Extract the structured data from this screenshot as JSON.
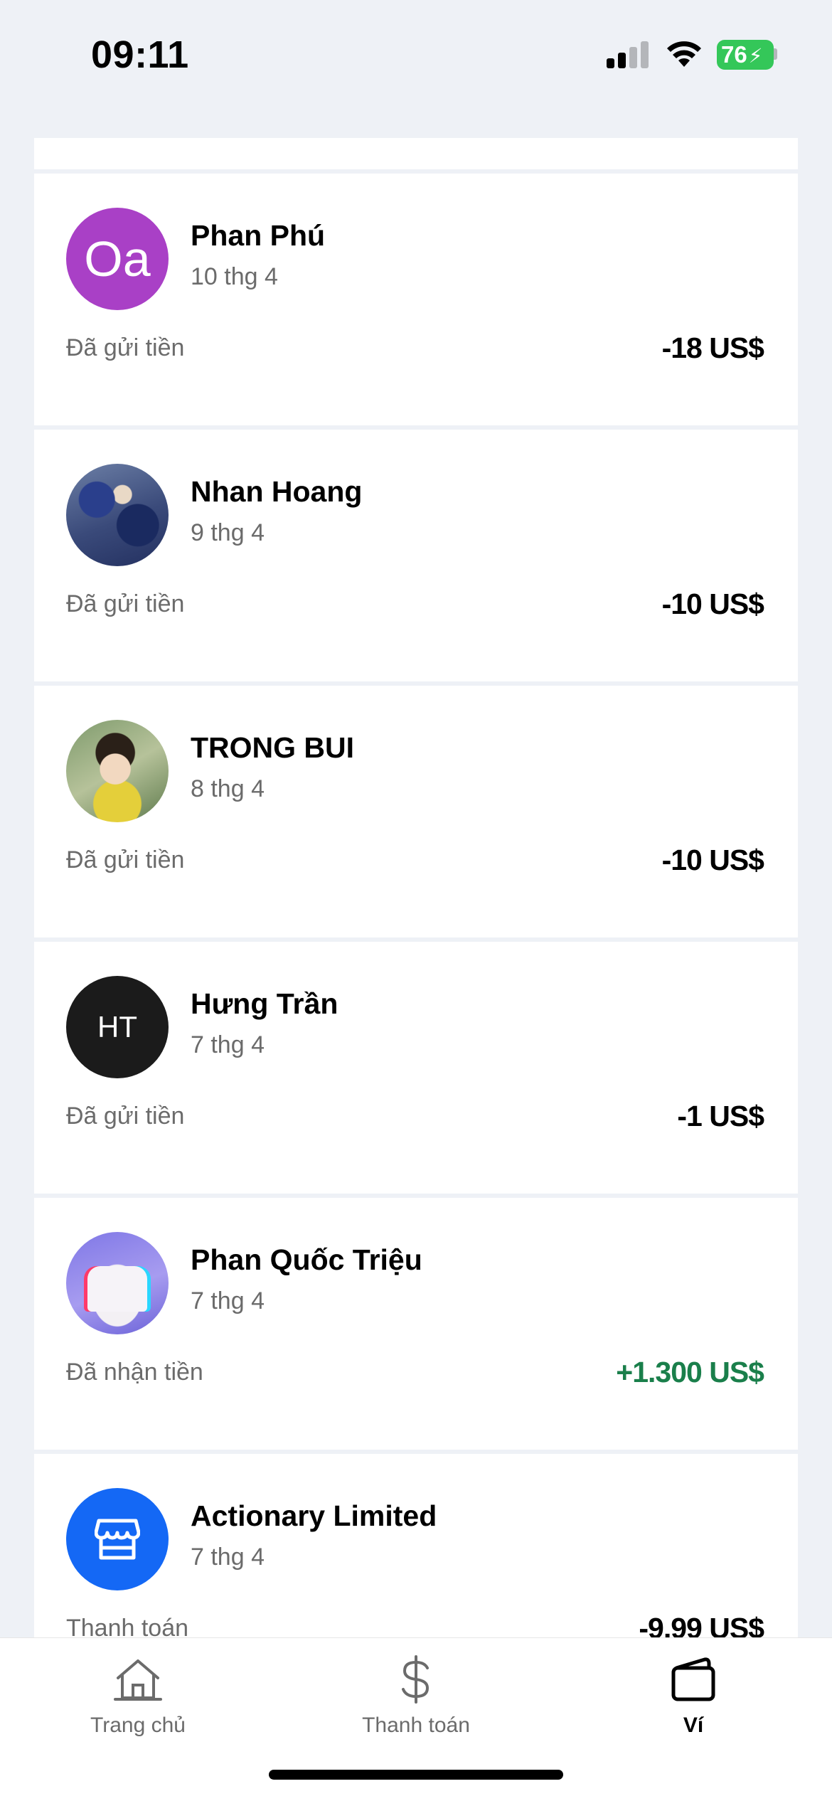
{
  "status_bar": {
    "time": "09:11",
    "battery": "76"
  },
  "transactions": [
    {
      "name": "Phan Phú",
      "date": "10 thg 4",
      "kind": "Đã gửi tiền",
      "amount": "-18 US$",
      "avatar_initials": "Oa",
      "avatar_color": "#a940c6"
    },
    {
      "name": "Nhan Hoang",
      "date": "9 thg 4",
      "kind": "Đã gửi tiền",
      "amount": "-10 US$"
    },
    {
      "name": "TRONG BUI",
      "date": "8 thg 4",
      "kind": "Đã gửi tiền",
      "amount": "-10 US$"
    },
    {
      "name": "Hưng Trần",
      "date": "7 thg 4",
      "kind": "Đã gửi tiền",
      "amount": "-1 US$",
      "avatar_initials": "HT",
      "avatar_color": "#1b1b1b"
    },
    {
      "name": "Phan Quốc Triệu",
      "date": "7 thg 4",
      "kind": "Đã nhận tiền",
      "amount": "+1.300 US$",
      "amount_color": "#1a7f4b"
    },
    {
      "name": "Actionary Limited",
      "date": "7 thg 4",
      "kind": "Thanh toán",
      "amount": "-9,99 US$",
      "avatar_icon": "storefront-icon",
      "avatar_color": "#1468f5"
    }
  ],
  "bottom_nav": {
    "items": [
      {
        "label": "Trang chủ",
        "icon": "home-icon"
      },
      {
        "label": "Thanh toán",
        "icon": "dollar-icon"
      },
      {
        "label": "Ví",
        "icon": "wallet-icon",
        "active": true
      }
    ]
  }
}
